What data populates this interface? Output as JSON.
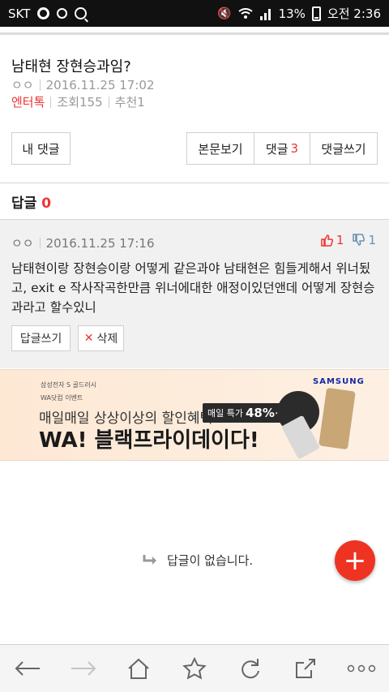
{
  "status_bar": {
    "carrier": "SKT",
    "battery": "13%",
    "time": "오전 2:36"
  },
  "post": {
    "title": "남태현 장현승과임?",
    "author": "ㅇㅇ",
    "date": "2016.11.25 17:02",
    "category": "엔터톡",
    "views": "조회155",
    "recommends": "추천1"
  },
  "actions": {
    "my_comments": "내 댓글",
    "view_post": "본문보기",
    "comments_label": "댓글",
    "comments_count": "3",
    "write_comment": "댓글쓰기"
  },
  "replies": {
    "label": "답글",
    "count": "0"
  },
  "comment": {
    "author": "ㅇㅇ",
    "date": "2016.11.25 17:16",
    "upvotes": "1",
    "downvotes": "1",
    "text": "남태현이랑 장현승이랑 어떻게 같은과야 남태현은 힘들게해서 위너됬고, exit e 작사작곡한만큼 위너에대한 애정이있던앤데 어떻게 장현승과라고 할수있니",
    "reply_button": "답글쓰기",
    "delete_button": "삭제"
  },
  "ad": {
    "brand_line1": "삼성전자 S 골드러시",
    "brand_line2": "WA닷컴 이벤트",
    "samsung": "SAMSUNG",
    "line1": "매일매일 상상이상의 할인혜택",
    "tag_label": "매일 특가",
    "tag_value": "48%~",
    "headline": "WA! 블랙프라이데이다!"
  },
  "empty_state": {
    "text": "답글이 없습니다."
  }
}
